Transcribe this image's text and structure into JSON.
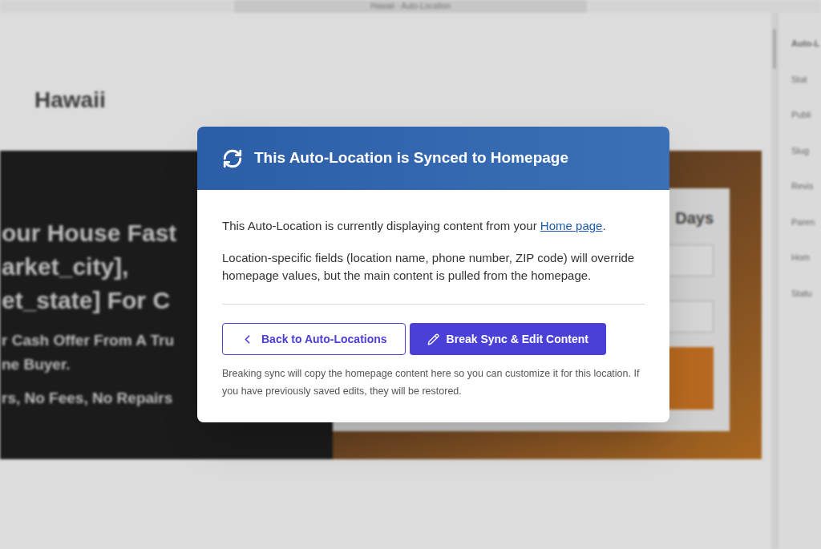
{
  "editor": {
    "title": "Hawaii · Auto-Location",
    "page_heading": "Hawaii",
    "hero_lines": [
      "our House Fast",
      "arket_city],",
      "et_state] For C"
    ],
    "hero_sub": [
      "r Cash Offer From A Tru",
      "ne Buyer."
    ],
    "hero_features": "rs, No Fees, No Repairs",
    "form_heading": "Days",
    "sidebar_tab": "Auto-L",
    "sidebar_labels": [
      "Stat",
      "Publi",
      "Slug",
      "Revis",
      "Paren",
      "Hom",
      "Statu"
    ]
  },
  "modal": {
    "title": "This Auto-Location is Synced to Homepage",
    "intro_prefix": "This Auto-Location is currently displaying content from your ",
    "intro_link": "Home page",
    "intro_suffix": ".",
    "details": "Location-specific fields (location name, phone number, ZIP code) will override homepage values, but the main content is pulled from the homepage.",
    "buttons": [
      {
        "label": "Back to Auto-Locations",
        "kind": "secondary"
      },
      {
        "label": "Break Sync & Edit Content",
        "kind": "primary"
      }
    ],
    "note": "Breaking sync will copy the homepage content here so you can customize it for this location. If you have previously saved edits, they will be restored."
  }
}
